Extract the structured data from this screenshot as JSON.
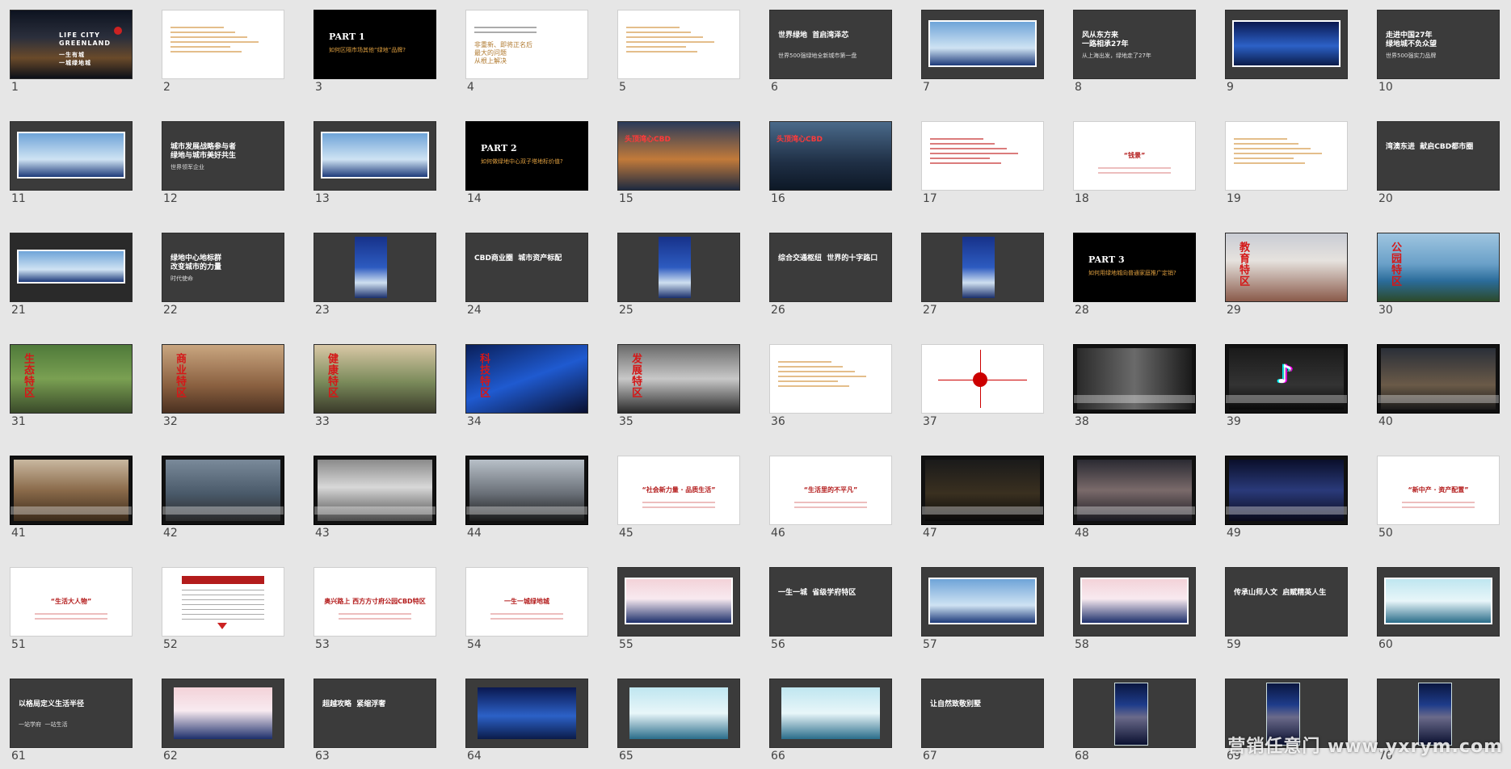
{
  "watermark": "营销任意门  www.yxrym.com",
  "slides": [
    {
      "n": "1",
      "style": "cover",
      "title": "LIFE CITY\nGREENLAND",
      "sub": "一生有城\n一城绿地城"
    },
    {
      "n": "2",
      "style": "white-lines"
    },
    {
      "n": "3",
      "style": "part",
      "title": "PART 1",
      "sub": "如何区隔市场其他“绿地”品牌?"
    },
    {
      "n": "4",
      "style": "white-text",
      "text": "非重新、即将正名后\n最大的问题\n从根上解决"
    },
    {
      "n": "5",
      "style": "white-lines"
    },
    {
      "n": "6",
      "style": "dark-title",
      "title": "世界绿地  首启湾泽芯",
      "sub": "世界500强绿地全新城市第一盘"
    },
    {
      "n": "7",
      "style": "banner"
    },
    {
      "n": "8",
      "style": "dark-title",
      "title": "风从东方来\n一路相承27年",
      "sub": "从上海出发，绿地走了27年"
    },
    {
      "n": "9",
      "style": "banner-night"
    },
    {
      "n": "10",
      "style": "dark-title",
      "title": "走进中国27年\n绿地城不负众望",
      "sub": "世界500强实力品牌"
    },
    {
      "n": "11",
      "style": "banner"
    },
    {
      "n": "12",
      "style": "dark-title",
      "title": "城市发展战略参与者\n绿地与城市美好共生",
      "sub": "世界领军企业"
    },
    {
      "n": "13",
      "style": "banner"
    },
    {
      "n": "14",
      "style": "part",
      "title": "PART 2",
      "sub": "如何做绿地中心双子塔地标价值?"
    },
    {
      "n": "15",
      "style": "photo",
      "bg": "linear-gradient(180deg,#2a3a5a 0%,#c27a3a 55%,#1e2a40 100%)",
      "label": "头顶湾心CBD"
    },
    {
      "n": "16",
      "style": "photo",
      "bg": "linear-gradient(180deg,#4a6a8a 0%,#1f2f45 60%,#0d1826 100%)",
      "label": "头顶湾心CBD"
    },
    {
      "n": "17",
      "style": "white-lines-red"
    },
    {
      "n": "18",
      "style": "white-quote",
      "text": "“钱景”"
    },
    {
      "n": "19",
      "style": "white-lines"
    },
    {
      "n": "20",
      "style": "dark-title",
      "title": "湾澳东进  献启CBD都市圈",
      "sub": ""
    },
    {
      "n": "21",
      "style": "banner-dark"
    },
    {
      "n": "22",
      "style": "dark-title",
      "title": "绿地中心地标群\n改变城市的力量",
      "sub": "时代使命"
    },
    {
      "n": "23",
      "style": "poster"
    },
    {
      "n": "24",
      "style": "dark-title",
      "title": "CBD商业圈  城市资产标配",
      "sub": ""
    },
    {
      "n": "25",
      "style": "poster"
    },
    {
      "n": "26",
      "style": "dark-title",
      "title": "综合交通枢纽  世界的十字路口",
      "sub": ""
    },
    {
      "n": "27",
      "style": "poster"
    },
    {
      "n": "28",
      "style": "part",
      "title": "PART 3",
      "sub": "如何用绿地城向普通家庭推广定销?"
    },
    {
      "n": "29",
      "style": "vphoto",
      "bg": "linear-gradient(180deg,#c9ccd4 0%,#e6e2de 40%,#8a5a4a 100%)",
      "label": "教育特区"
    },
    {
      "n": "30",
      "style": "vphoto",
      "bg": "linear-gradient(180deg,#9fc5e0 0%,#6aa0c8 45%,#2b6c9a 70%,#2c4a2a 100%)",
      "label": "公园特区"
    },
    {
      "n": "31",
      "style": "vphoto",
      "bg": "linear-gradient(180deg,#4f7a3a 0%,#7aa052 50%,#3a4a2a 100%)",
      "label": "生态特区"
    },
    {
      "n": "32",
      "style": "vphoto",
      "bg": "linear-gradient(180deg,#c9a680 0%,#8a6040 60%,#4a3020 100%)",
      "label": "商业特区"
    },
    {
      "n": "33",
      "style": "vphoto",
      "bg": "linear-gradient(180deg,#d9c8a6 0%,#7a8a5a 55%,#3a3a2a 100%)",
      "label": "健康特区"
    },
    {
      "n": "34",
      "style": "vphoto",
      "bg": "linear-gradient(160deg,#0a1f5a 0%,#1f5ad0 50%,#0a1030 100%)",
      "label": "科技特区"
    },
    {
      "n": "35",
      "style": "vphoto",
      "bg": "linear-gradient(180deg,#6a6a6a 0%,#c8c8c8 50%,#2a2a2a 100%)",
      "label": "发展特区"
    },
    {
      "n": "36",
      "style": "white-lines"
    },
    {
      "n": "37",
      "style": "white-cross"
    },
    {
      "n": "38",
      "style": "framed-photo",
      "bg": "linear-gradient(90deg,#2a2a2a 0%,#6a6a6a 50%,#1a1a1a 100%)"
    },
    {
      "n": "39",
      "style": "tiktok"
    },
    {
      "n": "40",
      "style": "framed-photo",
      "bg": "linear-gradient(180deg,#2a2f38 0%,#6a5a48 60%,#1a1a1a 100%)"
    },
    {
      "n": "41",
      "style": "framed-photo",
      "bg": "linear-gradient(180deg,#c9b8a0 0%,#8a6a4a 50%,#3a2a1a 100%)"
    },
    {
      "n": "42",
      "style": "framed-photo",
      "bg": "linear-gradient(180deg,#7a8a9a 0%,#4a5a6a 55%,#2a2a2a 100%)"
    },
    {
      "n": "43",
      "style": "framed-photo",
      "bg": "linear-gradient(180deg,#8a8a8a 0%,#d8d8d8 45%,#4a4a4a 100%)"
    },
    {
      "n": "44",
      "style": "framed-photo",
      "bg": "linear-gradient(180deg,#b8c0c8 0%,#6a7078 55%,#1a1a1a 100%)"
    },
    {
      "n": "45",
      "style": "white-headline",
      "text": "“社会新力量 · 品质生活”"
    },
    {
      "n": "46",
      "style": "white-headline",
      "text": "“生活里的不平凡”"
    },
    {
      "n": "47",
      "style": "framed-photo",
      "bg": "linear-gradient(180deg,#1a1a1a 0%,#3a3020 55%,#0a0a0a 100%)"
    },
    {
      "n": "48",
      "style": "framed-photo",
      "bg": "linear-gradient(180deg,#2a2a32 0%,#7a6a6a 50%,#1a1a22 100%)"
    },
    {
      "n": "49",
      "style": "framed-photo",
      "bg": "linear-gradient(180deg,#0a0f2a 0%,#2a3a7a 50%,#0a0a1a 100%)"
    },
    {
      "n": "50",
      "style": "white-headline",
      "text": "“新中产 · 资产配置”"
    },
    {
      "n": "51",
      "style": "white-headline",
      "text": "“生活大人物”"
    },
    {
      "n": "52",
      "style": "white-table"
    },
    {
      "n": "53",
      "style": "white-headline",
      "text": "奥兴路上  西方方寸府公园CBD特区"
    },
    {
      "n": "54",
      "style": "white-headline",
      "text": "一生一城绿地城"
    },
    {
      "n": "55",
      "style": "banner-pink"
    },
    {
      "n": "56",
      "style": "dark-title",
      "title": "一生一城  省级学府特区",
      "sub": ""
    },
    {
      "n": "57",
      "style": "banner"
    },
    {
      "n": "58",
      "style": "banner-pink"
    },
    {
      "n": "59",
      "style": "dark-title",
      "title": "传承山师人文  启赋精英人生",
      "sub": ""
    },
    {
      "n": "60",
      "style": "banner-teal"
    },
    {
      "n": "61",
      "style": "dark-title",
      "title": "以格局定义生活半径",
      "sub": "一站学府  一站生活"
    },
    {
      "n": "62",
      "style": "banner-pink-wide"
    },
    {
      "n": "63",
      "style": "dark-title",
      "title": "超越攻略  紧缩浮奢",
      "sub": ""
    },
    {
      "n": "64",
      "style": "banner-night-wide"
    },
    {
      "n": "65",
      "style": "banner-teal-wide"
    },
    {
      "n": "66",
      "style": "banner-teal-wide"
    },
    {
      "n": "67",
      "style": "dark-title",
      "title": "让自然致敬别墅",
      "sub": ""
    },
    {
      "n": "68",
      "style": "poster-night"
    },
    {
      "n": "69",
      "style": "poster-night"
    },
    {
      "n": "70",
      "style": "poster-night"
    }
  ]
}
